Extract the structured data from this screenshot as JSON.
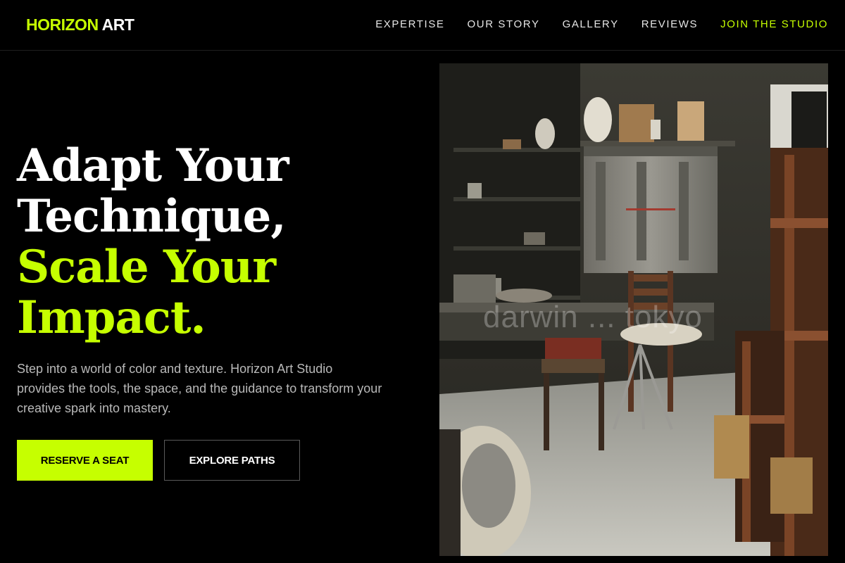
{
  "header": {
    "logo_accent": "HORIZON",
    "logo_plain": "ART",
    "nav": [
      {
        "label": "EXPERTISE"
      },
      {
        "label": "OUR STORY"
      },
      {
        "label": "GALLERY"
      },
      {
        "label": "REVIEWS"
      },
      {
        "label": "JOIN THE STUDIO"
      }
    ]
  },
  "hero": {
    "headline_lines": [
      "Adapt Your",
      "Technique,",
      "Scale Your",
      "Impact."
    ],
    "subtext": "Step into a world of color and texture. Horizon Art Studio provides the tools, the space, and the guidance to transform your creative spark into mastery.",
    "primary_button": "RESERVE A SEAT",
    "secondary_button": "EXPLORE PATHS"
  },
  "image": {
    "watermark": "darwin ... tokyo",
    "icon": "studio-photo"
  },
  "colors": {
    "background": "#000000",
    "accent": "#c6ff00",
    "text": "#ffffff",
    "muted": "#b9b9b9"
  }
}
